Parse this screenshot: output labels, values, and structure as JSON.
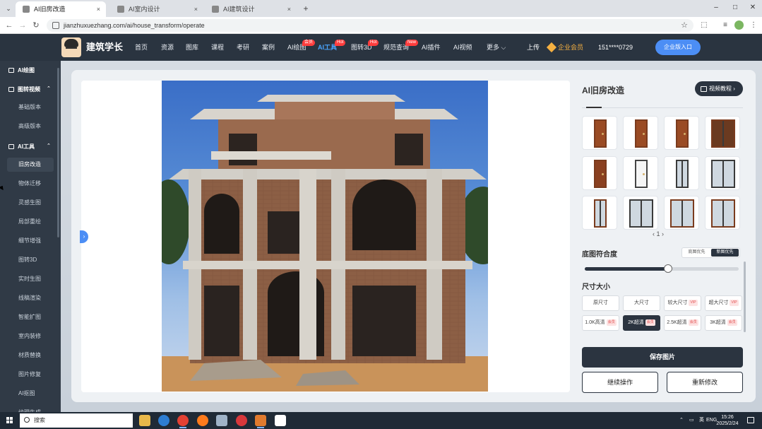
{
  "browser": {
    "tabs": [
      {
        "title": "AI旧房改造",
        "active": true
      },
      {
        "title": "AI室内设计",
        "active": false
      },
      {
        "title": "AI建筑设计",
        "active": false
      }
    ],
    "tab_close": "×",
    "new_tab": "+",
    "url": "jianzhuxuezhang.com/ai/house_transform/operate",
    "window_controls": [
      "–",
      "□",
      "✕"
    ]
  },
  "header": {
    "logo_text": "建筑学长",
    "nav": [
      {
        "label": "首页"
      },
      {
        "label": "资源"
      },
      {
        "label": "图库"
      },
      {
        "label": "课程"
      },
      {
        "label": "考研"
      },
      {
        "label": "案例"
      },
      {
        "label": "AI绘图",
        "badge": "会员"
      },
      {
        "label": "AI工具",
        "badge": "Hot",
        "active": true
      },
      {
        "label": "图转3D",
        "badge": "Hot"
      },
      {
        "label": "规范查询",
        "badge": "New"
      },
      {
        "label": "AI插件"
      },
      {
        "label": "AI视频"
      },
      {
        "label": "更多 ⌵"
      }
    ],
    "upload": "上传",
    "vip": "企业会员",
    "phone": "151****0729",
    "enterprise_button": "企业版入口"
  },
  "sidebar": {
    "groups": [
      {
        "label": "AI绘图",
        "chevron": ""
      },
      {
        "label": "图转视频",
        "chevron": "⌃"
      },
      {
        "label": "AI工具",
        "chevron": "⌃"
      }
    ],
    "video_items": [
      "基础版本",
      "高级版本"
    ],
    "tool_items": [
      "旧房改造",
      "物体迁移",
      "灵感生图",
      "局部重绘",
      "细节增强",
      "图转3D",
      "实时生图",
      "线稿渲染",
      "智能扩图",
      "室内装修",
      "材质替换",
      "图片修复",
      "AI抠图",
      "纹理生成"
    ]
  },
  "panel": {
    "title": "AI旧房改造",
    "video_tutorial": "视频教程",
    "pager": "‹  1  ›",
    "fit_label": "底图符合度",
    "fit_options": [
      "底图优先",
      "新图优先"
    ],
    "fit_selected": 1,
    "fit_value": 0.54,
    "size_label": "尺寸大小",
    "sizes": [
      {
        "label": "原尺寸",
        "tag": ""
      },
      {
        "label": "大尺寸",
        "tag": ""
      },
      {
        "label": "较大尺寸",
        "tag": "VIP"
      },
      {
        "label": "超大尺寸",
        "tag": "VIP"
      },
      {
        "label": "1.0K高清",
        "tag": "会员"
      },
      {
        "label": "2K超清",
        "tag": "会员",
        "selected": true
      },
      {
        "label": "2.5K超清",
        "tag": "会员"
      },
      {
        "label": "3K超清",
        "tag": "会员"
      }
    ],
    "save_button": "保存图片",
    "continue_button": "继续操作",
    "redo_button": "重新修改"
  },
  "taskbar": {
    "search_placeholder": "搜索",
    "tray_ime": "英",
    "tray_lang": "ENG",
    "time": "15:26",
    "date": "2025/2/24"
  },
  "colors": {
    "header_bg": "#2a3440",
    "sidebar_bg": "#303a46",
    "accent": "#4c8ef5",
    "primary_button": "#2b3440",
    "badge_red": "#ff3d3d"
  }
}
